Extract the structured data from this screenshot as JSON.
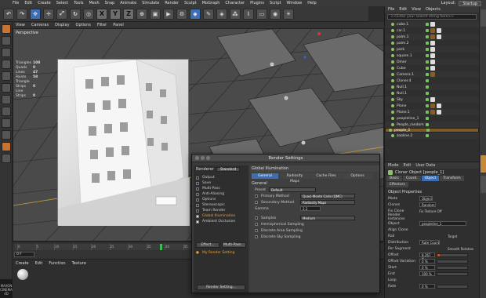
{
  "menu": [
    "File",
    "Edit",
    "Create",
    "Select",
    "Tools",
    "Mesh",
    "Snap",
    "Animate",
    "Simulate",
    "Render",
    "Sculpt",
    "MoGraph",
    "Character",
    "Plugins",
    "Script",
    "Window",
    "Help"
  ],
  "layout": {
    "label": "Layout:",
    "value": "Startup"
  },
  "viewport": {
    "menu": [
      "View",
      "Cameras",
      "Display",
      "Options",
      "Filter",
      "Panel"
    ],
    "label": "Perspective",
    "stats": [
      {
        "k": "Triangles",
        "v": "108"
      },
      {
        "k": "Quads",
        "v": "0"
      },
      {
        "k": "Lines",
        "v": "47"
      },
      {
        "k": "Points",
        "v": "58"
      },
      {
        "k": "Triangle Strips",
        "v": "0"
      },
      {
        "k": "Line Strips",
        "v": "0"
      }
    ]
  },
  "timeline": {
    "frame": "0 F",
    "ticks": [
      "0",
      "5",
      "10",
      "15",
      "20",
      "25",
      "30",
      "35",
      "40",
      "45",
      "50",
      "55",
      "60",
      "65",
      "70",
      "75",
      "80",
      "85",
      "90"
    ]
  },
  "material": {
    "menu": [
      "Create",
      "Edit",
      "Function",
      "Texture"
    ]
  },
  "logo": "MAXON CINEMA 4D",
  "objects": {
    "menu": [
      "File",
      "Edit",
      "View",
      "Objects"
    ],
    "search": "<<Enter your search string here>>",
    "items": [
      "cube.1",
      "car.1",
      "palm.1",
      "palm.2",
      "park",
      "square.1",
      "Omer",
      "Cube",
      "Camera.1",
      "Cloner.4",
      "Null.1",
      "Null.1",
      "Sky",
      "Plane",
      "Plane.1",
      "peopleline_1",
      "People_random",
      "people_1",
      "zooline.2"
    ]
  },
  "attributes": {
    "menu": [
      "Mode",
      "Edit",
      "User Data"
    ],
    "object_title": "Cloner Object [people_1]",
    "tabs": [
      "Basic",
      "Coord.",
      "Object",
      "Transform",
      "Effectors"
    ],
    "active_tab": "Object",
    "section": "Object Properties",
    "rows": [
      {
        "label": "Mode",
        "value": "Object"
      },
      {
        "label": "Clones",
        "value": "Random"
      },
      {
        "label": "Fix Clone",
        "value": "Fix Texture  Off"
      },
      {
        "label": "Render Instances",
        "value": ""
      },
      {
        "label": "Object",
        "value": "peopleline_1"
      },
      {
        "label": "Align Clone",
        "value": ""
      },
      {
        "label": "Rail",
        "value": "Target"
      },
      {
        "label": "Distribution",
        "value": "Rate   Count"
      },
      {
        "label": "Per Segment",
        "value": "Smooth Rotation"
      },
      {
        "label": "Offset",
        "value": "8.267 %"
      },
      {
        "label": "Offset Variation",
        "value": "0 %"
      },
      {
        "label": "Start",
        "value": "0 %"
      },
      {
        "label": "End",
        "value": "100 %"
      },
      {
        "label": "Loop",
        "value": ""
      },
      {
        "label": "Rate",
        "value": "0 %"
      }
    ],
    "offset_fraction": 0.08
  },
  "dialog": {
    "title": "Render Settings",
    "renderer_label": "Renderer",
    "renderer": "Standard",
    "left_items": [
      "Output",
      "Save",
      "Multi-Pass",
      "Anti-Aliasing",
      "Options",
      "Stereoscopic",
      "Team Render",
      "Global Illumination",
      "Ambient Occlusion"
    ],
    "effect_btn": "Effect...",
    "multipass_btn": "Multi-Pass...",
    "my_render": "My Render Setting",
    "render_settings_btn": "Render Setting...",
    "section": "Global Illumination",
    "tabs": [
      "General",
      "Radiosity Maps",
      "Cache Files",
      "Options"
    ],
    "general": "General",
    "preset_label": "Preset",
    "preset": "Default",
    "primary_label": "Primary Method",
    "primary": "Quasi-Monte Carlo (QMC)",
    "secondary_label": "Secondary Method",
    "secondary": "Radiosity Maps",
    "gamma_label": "Gamma",
    "gamma": "2.2",
    "samples_label": "Samples",
    "samples": "Medium",
    "checks": [
      "Hemispherical Sampling",
      "Discrete Area Sampling",
      "Discrete Sky Sampling"
    ]
  }
}
